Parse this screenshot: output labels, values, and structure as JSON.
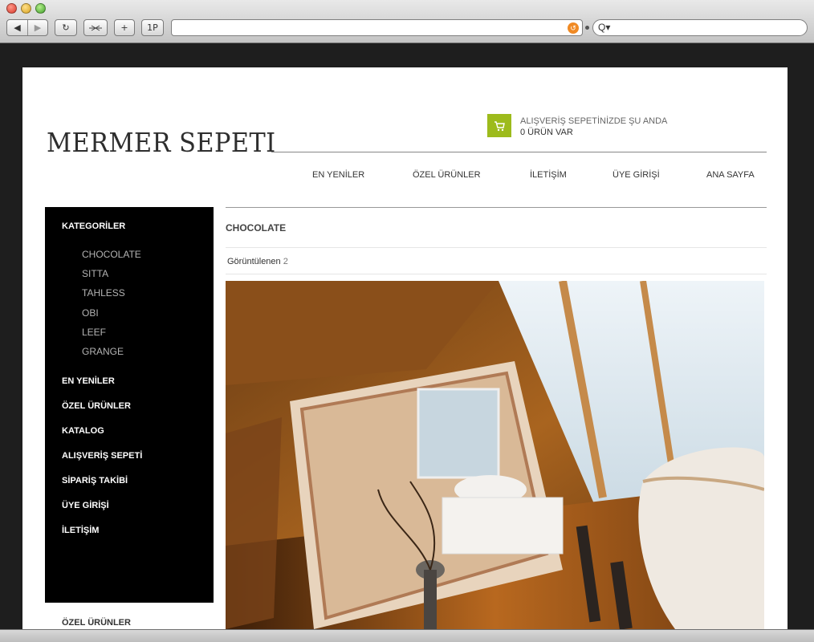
{
  "browser": {
    "toolbar": {
      "back": "◀",
      "forward": "▶",
      "reload": "↻",
      "add": "+",
      "one_p": "1P"
    },
    "url": "",
    "search_icon": "Q▾",
    "rss_icon": "rss-icon"
  },
  "site": {
    "logo": "MERMER SEPETI",
    "cart": {
      "line1": "ALIŞVERİŞ SEPETİNİZDE ŞU ANDA",
      "line2": "0 ÜRÜN VAR"
    },
    "topnav": [
      "EN YENİLER",
      "ÖZEL ÜRÜNLER",
      "İLETİŞİM",
      "ÜYE GİRİŞİ",
      "ANA SAYFA"
    ],
    "sidebar": {
      "categories_title": "KATEGORİLER",
      "categories": [
        "CHOCOLATE",
        "SITTA",
        "TAHLESS",
        "OBI",
        "LEEF",
        "GRANGE"
      ],
      "links": [
        "EN YENİLER",
        "ÖZEL ÜRÜNLER",
        "KATALOG",
        "ALIŞVERİŞ SEPETİ",
        "SİPARİŞ TAKİBİ",
        "ÜYE GİRİŞİ",
        "İLETİŞİM"
      ],
      "footer_title": "ÖZEL ÜRÜNLER"
    },
    "content": {
      "title": "CHOCOLATE",
      "viewed_label": "Görüntülenen",
      "viewed_count": "2"
    }
  },
  "colors": {
    "accent_green": "#9dbb1c",
    "sidebar_bg": "#000000"
  }
}
